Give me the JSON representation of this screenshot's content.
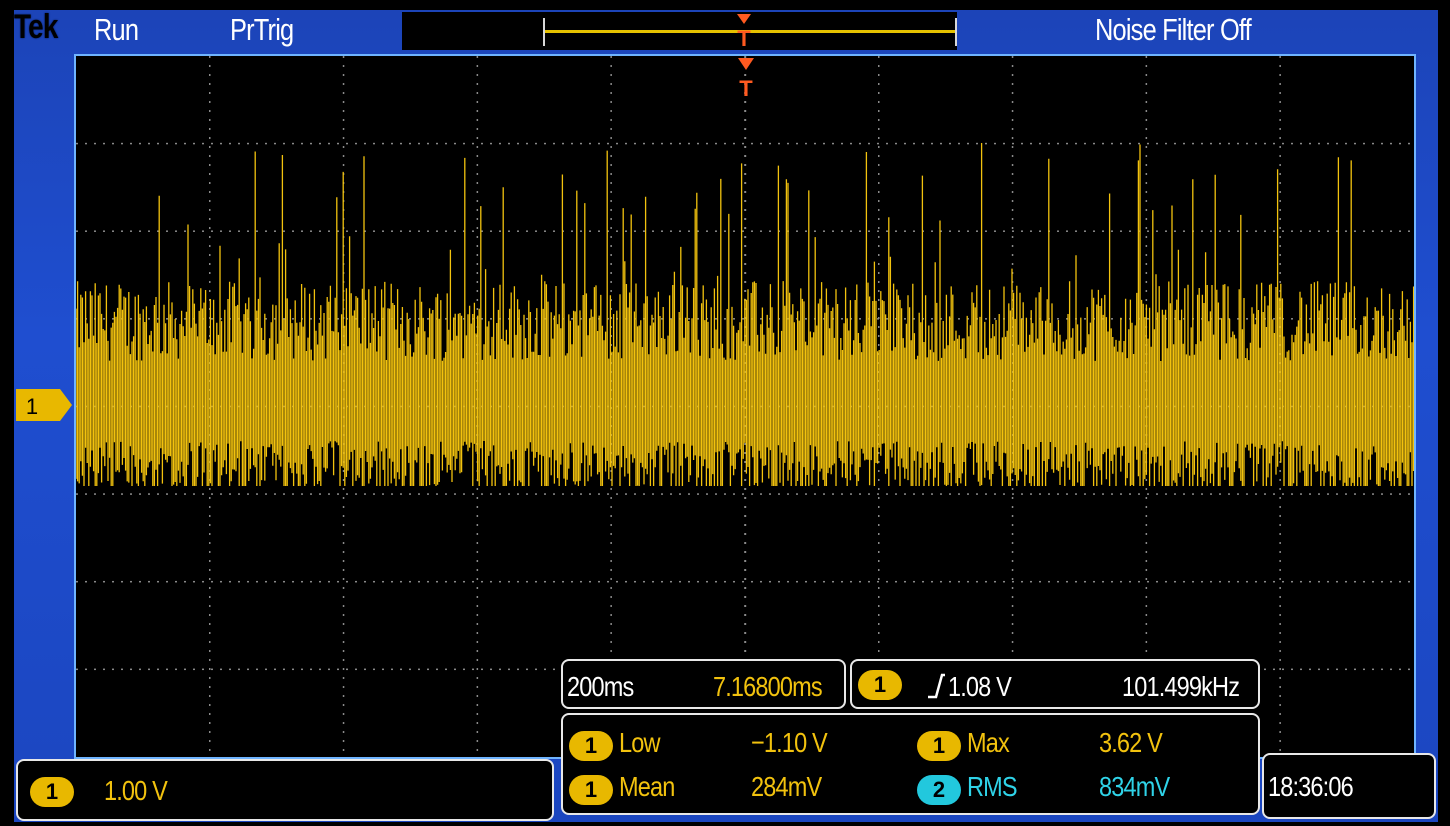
{
  "topbar": {
    "brand": "Tek",
    "acq_state": "Run",
    "trigger_state": "PrTrig",
    "noise_filter": "Noise Filter Off"
  },
  "channel": {
    "number": "1",
    "color": "#f2c20e",
    "scale": "1.00 V"
  },
  "timebase": {
    "scale": "200ms",
    "position": "7.16800ms"
  },
  "trigger": {
    "source": "1",
    "slope_icon": "rising-edge-icon",
    "level": "1.08 V",
    "frequency": "101.499kHz"
  },
  "measurements": [
    {
      "source": "1",
      "label": "Low",
      "value": "−1.10 V",
      "color": "#f2c20e"
    },
    {
      "source": "1",
      "label": "Max",
      "value": "3.62 V",
      "color": "#f2c20e"
    },
    {
      "source": "1",
      "label": "Mean",
      "value": "284mV",
      "color": "#f2c20e"
    },
    {
      "source": "2",
      "label": "RMS",
      "value": "834mV",
      "color": "#2fd3e8"
    }
  ],
  "clock": "18:36:06",
  "colors": {
    "frame_blue": "#1f4ed0",
    "grid": "#8a8a8a",
    "trace": "#f2c20e",
    "trigger_marker": "#ff5a20"
  }
}
